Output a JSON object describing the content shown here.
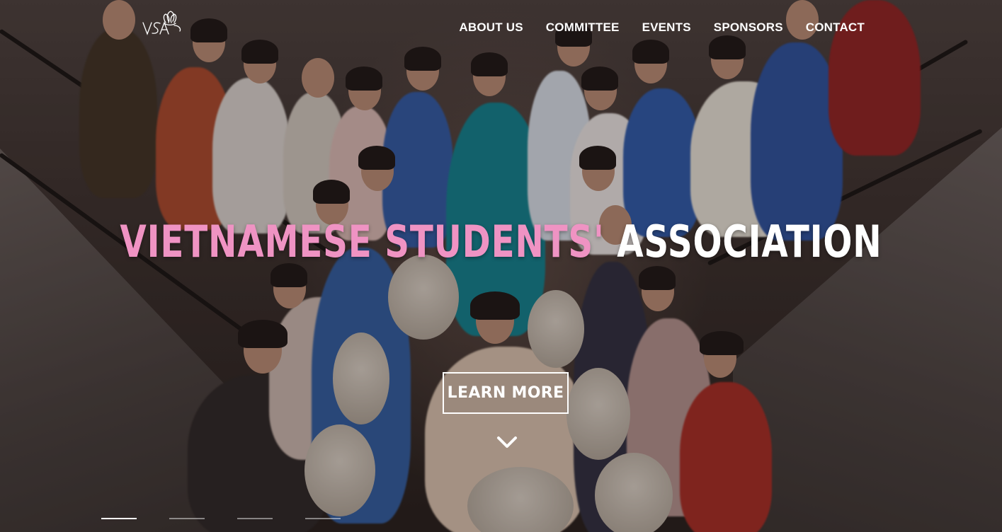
{
  "header": {
    "logo_icon": "vsa-lotus-logo",
    "nav": [
      {
        "label": "ABOUT US"
      },
      {
        "label": "COMMITTEE"
      },
      {
        "label": "EVENTS"
      },
      {
        "label": "SPONSORS"
      },
      {
        "label": "CONTACT"
      }
    ]
  },
  "hero": {
    "title_part1": "VIETNAMESE STUDENTS'",
    "title_part2": "ASSOCIATION",
    "title_accent_color": "#ef93c3",
    "cta_label": "LEARN MORE",
    "scroll_icon": "chevron-down-icon",
    "slides": [
      {
        "active": true
      },
      {
        "active": false
      },
      {
        "active": false
      },
      {
        "active": false
      }
    ]
  }
}
